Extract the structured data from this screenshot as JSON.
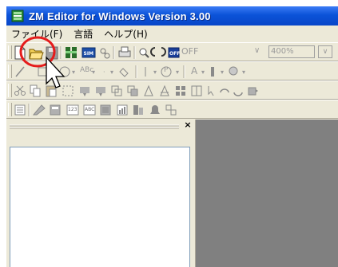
{
  "window": {
    "title": "ZM Editor for Windows Version 3.00",
    "accent_color": "#0b53d8",
    "icon": "app-icon"
  },
  "menubar": {
    "items": [
      {
        "label": "ファイル(F)"
      },
      {
        "label": "言語"
      },
      {
        "label": "ヘルプ(H)"
      }
    ]
  },
  "toolbar1": {
    "icons": [
      "new-file-icon",
      "open-folder-icon",
      "save-icon",
      "transfer-icon",
      "sim-icon",
      "network-icon",
      "print-icon",
      "zoom-icon",
      "snap-icon",
      "off-icon"
    ],
    "off_label": "OFF",
    "zoom_value": "400%",
    "zoom_dropdown": "chevron-down-icon"
  },
  "toolbar2": {
    "icons": [
      "line-icon",
      "rectangle-icon",
      "circle-icon",
      "text-icon",
      "fill-icon",
      "paint-icon",
      "line-style-icon",
      "pattern-icon",
      "text-color-icon",
      "fill-color-icon",
      "figure-icon"
    ],
    "text_sample": "ABc",
    "pattern_label": "P",
    "font_label": "A"
  },
  "toolbar3": {
    "icons": [
      "cut-icon",
      "copy-icon",
      "paste-icon",
      "grid-icon",
      "align-icon",
      "group-icon",
      "bring-front-icon",
      "send-back-icon",
      "flip-horizontal-icon",
      "flip-vertical-icon",
      "multi-icon",
      "move-icon",
      "undo-icon",
      "redo-icon",
      "exit-icon"
    ]
  },
  "toolbar4": {
    "icons": [
      "part-list-icon",
      "chart-icon",
      "lamp-icon",
      "numeric-icon",
      "abc-text-icon",
      "switch-icon",
      "graph-icon",
      "trend-icon",
      "alarm-icon",
      "misc-icon"
    ],
    "numeric_label": "123",
    "abc_label": "ABC"
  },
  "annotation": {
    "highlight_color": "#e51c1c",
    "highlight_target": "open-folder-icon",
    "cursor": "mouse-cursor-icon"
  },
  "panel": {
    "close_icon": "close-icon"
  }
}
